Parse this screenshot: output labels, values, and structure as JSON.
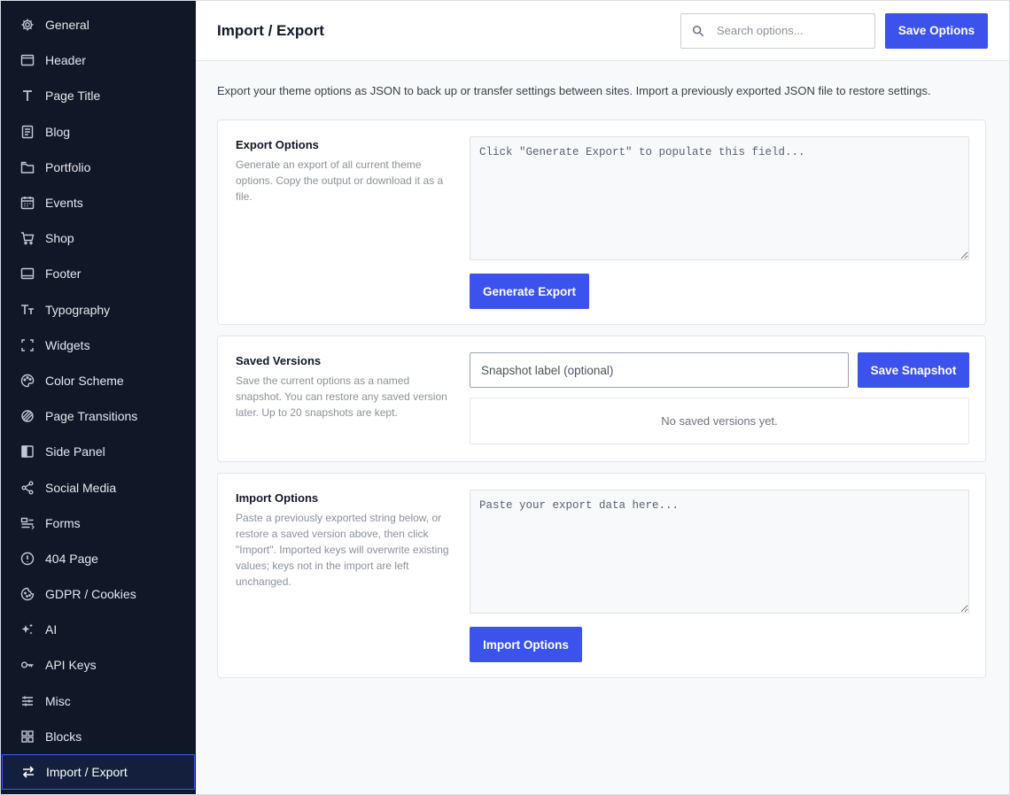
{
  "sidebar": {
    "items": [
      {
        "label": "General",
        "icon": "gear-icon"
      },
      {
        "label": "Header",
        "icon": "window-icon"
      },
      {
        "label": "Page Title",
        "icon": "text-t-icon"
      },
      {
        "label": "Blog",
        "icon": "document-icon"
      },
      {
        "label": "Portfolio",
        "icon": "briefcase-icon"
      },
      {
        "label": "Events",
        "icon": "calendar-icon"
      },
      {
        "label": "Shop",
        "icon": "cart-icon"
      },
      {
        "label": "Footer",
        "icon": "footer-icon"
      },
      {
        "label": "Typography",
        "icon": "typography-icon"
      },
      {
        "label": "Widgets",
        "icon": "widgets-icon"
      },
      {
        "label": "Color Scheme",
        "icon": "palette-icon"
      },
      {
        "label": "Page Transitions",
        "icon": "transitions-icon"
      },
      {
        "label": "Side Panel",
        "icon": "side-panel-icon"
      },
      {
        "label": "Social Media",
        "icon": "share-icon"
      },
      {
        "label": "Forms",
        "icon": "form-icon"
      },
      {
        "label": "404 Page",
        "icon": "alert-circle-icon"
      },
      {
        "label": "GDPR / Cookies",
        "icon": "cookie-icon"
      },
      {
        "label": "AI",
        "icon": "sparkle-icon"
      },
      {
        "label": "API Keys",
        "icon": "key-icon"
      },
      {
        "label": "Misc",
        "icon": "sliders-icon"
      },
      {
        "label": "Blocks",
        "icon": "grid-icon"
      },
      {
        "label": "Import / Export",
        "icon": "swap-arrows-icon",
        "active": true
      }
    ]
  },
  "header": {
    "title": "Import / Export",
    "search_placeholder": "Search options...",
    "save_label": "Save Options"
  },
  "intro": "Export your theme options as JSON to back up or transfer settings between sites. Import a previously exported JSON file to restore settings.",
  "export_card": {
    "title": "Export Options",
    "description": "Generate an export of all current theme options. Copy the output or download it as a file.",
    "textarea_placeholder": "Click \"Generate Export\" to populate this field...",
    "button_label": "Generate Export"
  },
  "versions_card": {
    "title": "Saved Versions",
    "description": "Save the current options as a named snapshot. You can restore any saved version later. Up to 20 snapshots are kept.",
    "input_placeholder": "Snapshot label (optional)",
    "button_label": "Save Snapshot",
    "empty_text": "No saved versions yet."
  },
  "import_card": {
    "title": "Import Options",
    "description": "Paste a previously exported string below, or restore a saved version above, then click \"Import\". Imported keys will overwrite existing values; keys not in the import are left unchanged.",
    "textarea_placeholder": "Paste your export data here...",
    "button_label": "Import Options"
  },
  "colors": {
    "sidebar_bg": "#101828",
    "accent": "#3b52ec",
    "active_border": "#3b5bfd",
    "page_bg": "#f8f9fb"
  }
}
